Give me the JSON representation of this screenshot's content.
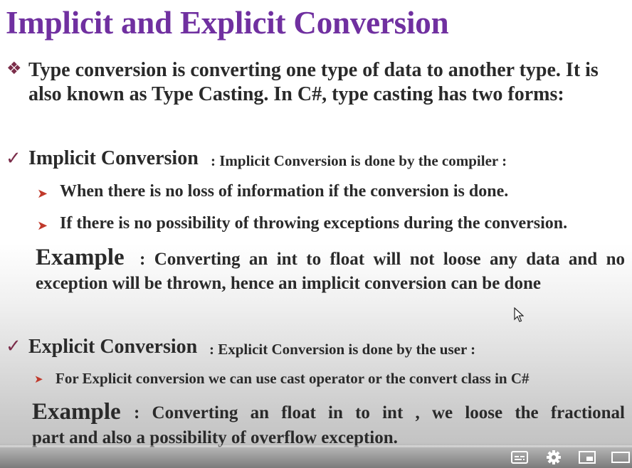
{
  "title": "Implicit and Explicit Conversion",
  "intro": {
    "line1": "Type conversion is converting one type of data to another type. It is",
    "line2": "also known as Type Casting. In C#, type casting has two forms:"
  },
  "implicit": {
    "heading": "Implicit Conversion",
    "desc": ":  Implicit Conversion is done by the compiler :",
    "points": [
      "When there is no loss of information if the conversion is done.",
      "If  there is no possibility of throwing exceptions during the conversion."
    ],
    "example_label": "Example",
    "example_line1": ":  Converting  an  int  to  float  will  not  loose  any  data  and  no",
    "example_line2": "exception will be thrown, hence an implicit conversion can be done"
  },
  "explicit": {
    "heading": "Explicit Conversion",
    "desc": ":  Explicit Conversion is done by the user :",
    "points": [
      "For Explicit conversion we can use cast operator or the convert class in C#"
    ],
    "example_label": "Example",
    "example_line1": ":  Converting  an  float  in  to  int  ,  we  loose  the  fractional",
    "example_line2": "part  and also a possibility of overflow exception."
  },
  "player_controls": {
    "icons": [
      "subtitles-icon",
      "gear-icon",
      "miniplayer-icon",
      "theater-mode-icon"
    ]
  }
}
